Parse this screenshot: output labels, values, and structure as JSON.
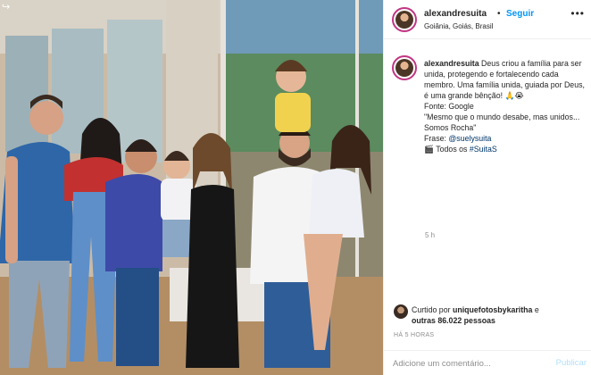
{
  "header": {
    "username": "alexandresuita",
    "dot": "•",
    "follow_label": "Seguir",
    "location": "Goiânia, Goiás, Brasil"
  },
  "caption": {
    "username": "alexandresuita",
    "text_1": " Deus criou a família para ser unida, protegendo e fortalecendo cada membro. Uma família unida, guiada por Deus, é uma grande bênção! 🙏😭",
    "source_line": "Fonte: Google",
    "quote_line": "\"Mesmo que o mundo desabe, mas unidos... Somos Rocha\"",
    "frase_label": "Frase: ",
    "frase_mention": "@suelysuita",
    "closing_prefix": "🎬 Todos os ",
    "closing_hashtag": "#SuitaS",
    "time": "5 h"
  },
  "likes": {
    "prefix": "Curtido por ",
    "liker": "uniquefotosbykaritha",
    "connector": " e ",
    "others": "outras 86.022 pessoas"
  },
  "posted": "HÁ 5 HORAS",
  "comment": {
    "placeholder": "Adicione um comentário...",
    "publish_label": "Publicar"
  },
  "icons": {
    "photo_corner": "carousel-arrow-icon",
    "more": "more-options-icon"
  },
  "colors": {
    "follow_blue": "#0095f6",
    "link_blue": "#00376b",
    "publish_disabled": "#b2dffc",
    "story_ring": "#c13584"
  }
}
